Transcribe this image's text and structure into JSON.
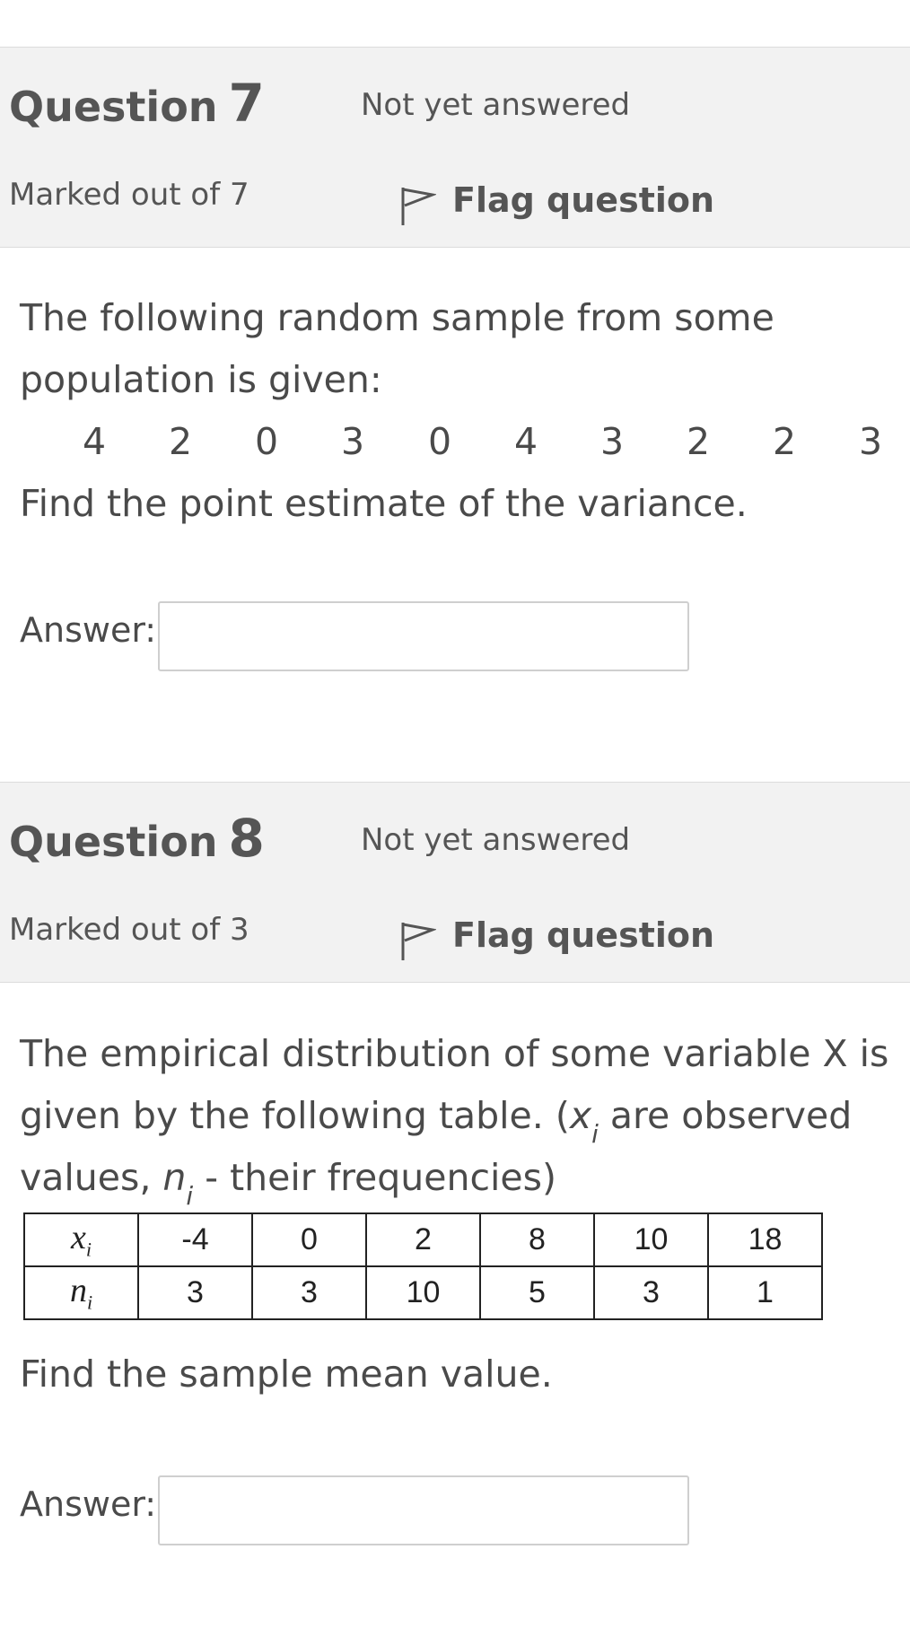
{
  "questions": [
    {
      "word": "Question",
      "number": "7",
      "state": "Not yet answered",
      "grade": "Marked out of 7",
      "flag_label": "Flag question",
      "text_lines": [
        "The following random sample from some",
        "population is given:"
      ],
      "sample": [
        "4",
        "2",
        "0",
        "3",
        "0",
        "4",
        "3",
        "2",
        "2",
        "3"
      ],
      "prompt": "Find the point estimate of the variance.",
      "answer_label": "Answer:",
      "answer_value": ""
    },
    {
      "word": "Question",
      "number": "8",
      "state": "Not yet answered",
      "grade": "Marked out of 3",
      "flag_label": "Flag question",
      "line1": "The empirical distribution of some variable X is",
      "line2_a": "given by the following table. (",
      "line2_x": "x",
      "line2_sub": "i",
      "line2_b": " are observed",
      "line3_a": "values, ",
      "line3_n": "n",
      "line3_sub": "i",
      "line3_b": " - their frequencies)",
      "table": {
        "row1_label": "x",
        "row1_sub": "i",
        "row1_values": [
          "-4",
          "0",
          "2",
          "8",
          "10",
          "18"
        ],
        "row2_label": "n",
        "row2_sub": "i",
        "row2_values": [
          "3",
          "3",
          "10",
          "5",
          "3",
          "1"
        ]
      },
      "prompt": "Find the sample mean value.",
      "answer_label": "Answer:",
      "answer_value": ""
    }
  ]
}
